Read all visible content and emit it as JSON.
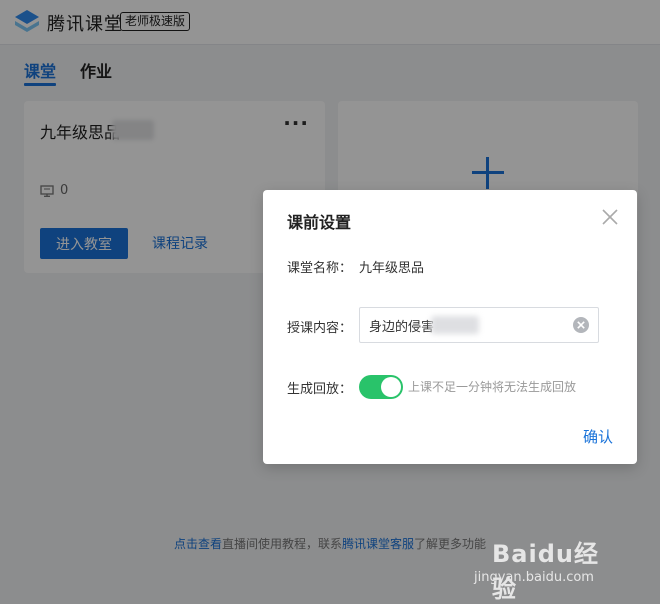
{
  "header": {
    "brand": "腾讯课堂",
    "edition_badge": "老师极速版"
  },
  "tabs": [
    {
      "label": "课堂",
      "active": true
    },
    {
      "label": "作业",
      "active": false
    }
  ],
  "class_card": {
    "title": "九年级思品",
    "more_label": "···",
    "student_count": "0",
    "enter_label": "进入教室",
    "record_label": "课程记录"
  },
  "add_card": {
    "icon": "plus-icon"
  },
  "footer": {
    "link1": "点击查看",
    "text1": "直播间使用教程，联系",
    "link2": "腾讯课堂客服",
    "text2": "了解更多功能"
  },
  "modal": {
    "title": "课前设置",
    "class_name_label": "课堂名称：",
    "class_name_value": "九年级思品",
    "content_label": "授课内容：",
    "content_value": "身边的侵害",
    "playback_label": "生成回放：",
    "playback_enabled": true,
    "playback_hint": "上课不足一分钟将无法生成回放",
    "confirm_label": "确认"
  },
  "watermark": {
    "brand": "Baidu经验",
    "url": "jingyan.baidu.com"
  },
  "colors": {
    "accent": "#1a73d9",
    "toggle_on": "#29c36a",
    "overlay": "rgba(0,0,0,0.42)"
  }
}
